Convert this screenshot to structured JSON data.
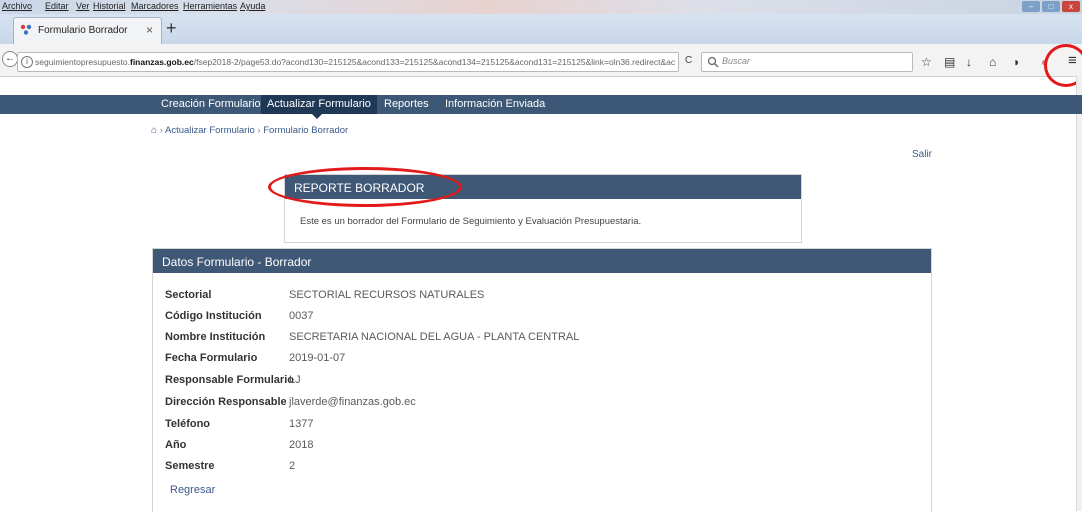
{
  "browser": {
    "menu": [
      "Archivo",
      "Editar",
      "Ver",
      "Historial",
      "Marcadores",
      "Herramientas",
      "Ayuda"
    ],
    "tab_title": "Formulario Borrador",
    "tab_close": "×",
    "new_tab": "+",
    "url_prefix": "seguimientopresupuesto.",
    "url_domain": "finanzas.gob.ec",
    "url_rest": "/fsep2018-2/page53.do?acond130=215125&acond133=215125&acond134=215125&acond131=215125&link=oln36.redirect&ac",
    "reload": "C",
    "search_placeholder": "Buscar",
    "window_buttons": [
      "–",
      "□",
      "x"
    ]
  },
  "app_nav": {
    "items": [
      "Creación Formulario",
      "Actualizar Formulario",
      "Reportes",
      "Información Enviada"
    ],
    "active_index": 1
  },
  "breadcrumb": {
    "items": [
      "Actualizar Formulario",
      "Formulario Borrador"
    ],
    "separator": "›"
  },
  "logout": "Salir",
  "report": {
    "title": "REPORTE BORRADOR",
    "body": "Este es un borrador del Formulario de Seguimiento y Evaluación Presupuestaria."
  },
  "form_data": {
    "title": "Datos Formulario - Borrador",
    "rows": [
      {
        "label": "Sectorial",
        "value": "SECTORIAL RECURSOS NATURALES"
      },
      {
        "label": "Código Institución",
        "value": "0037"
      },
      {
        "label": "Nombre Institución",
        "value": "SECRETARIA NACIONAL DEL AGUA - PLANTA CENTRAL"
      },
      {
        "label": "Fecha Formulario",
        "value": "2019-01-07"
      },
      {
        "label": "Responsable Formulario",
        "value": "LJ"
      },
      {
        "label": "Dirección Responsable",
        "value": "jlaverde@finanzas.gob.ec"
      },
      {
        "label": "Teléfono",
        "value": "1377"
      },
      {
        "label": "Año",
        "value": "2018"
      },
      {
        "label": "Semestre",
        "value": "2"
      }
    ],
    "back_link": "Regresar"
  },
  "colors": {
    "accent": "#3e5876",
    "active_nav": "#1f3856",
    "annotation": "#e21a1a",
    "link": "#3a5a8c"
  }
}
